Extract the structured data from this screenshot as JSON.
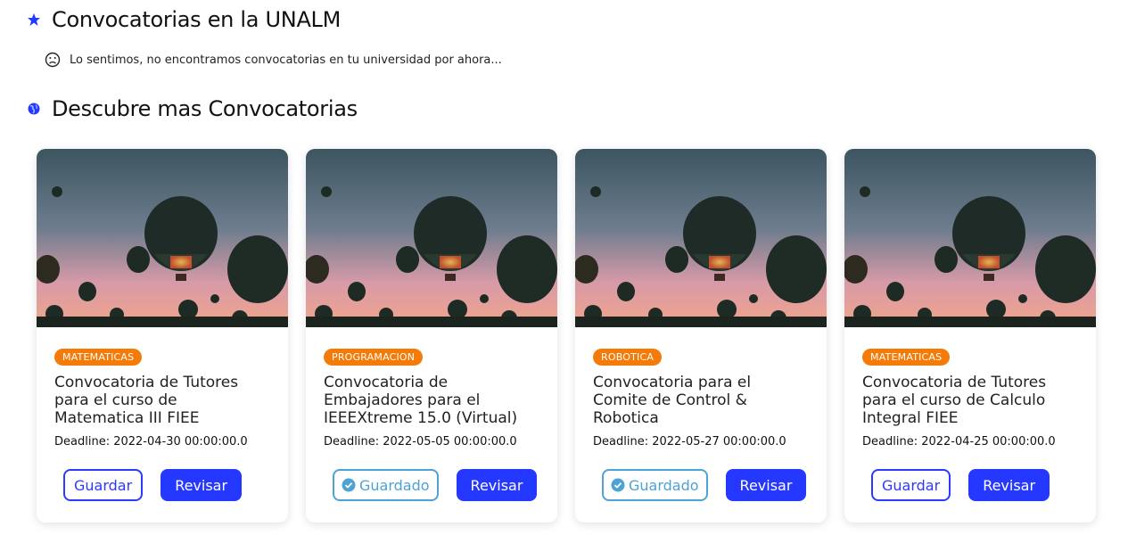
{
  "section1": {
    "title": "Convocatorias en la UNALM",
    "empty_message": "Lo sentimos, no encontramos convocatorias en tu universidad por ahora..."
  },
  "section2": {
    "title": "Descubre mas Convocatorias"
  },
  "cards": [
    {
      "tag": "MATEMATICAS",
      "title": "Convocatoria de Tutores para el curso de Matematica III FIEE",
      "deadline": "Deadline: 2022-04-30 00:00:00.0",
      "save_label": "Guardar",
      "saved": false,
      "review_label": "Revisar"
    },
    {
      "tag": "PROGRAMACION",
      "title": "Convocatoria de Embajadores para el IEEEXtreme 15.0 (Virtual)",
      "deadline": "Deadline: 2022-05-05 00:00:00.0",
      "save_label": "Guardado",
      "saved": true,
      "review_label": "Revisar"
    },
    {
      "tag": "ROBOTICA",
      "title": "Convocatoria para el Comite de Control & Robotica",
      "deadline": "Deadline: 2022-05-27 00:00:00.0",
      "save_label": "Guardado",
      "saved": true,
      "review_label": "Revisar"
    },
    {
      "tag": "MATEMATICAS",
      "title": "Convocatoria de Tutores para el curso de Calculo Integral FIEE",
      "deadline": "Deadline: 2022-04-25 00:00:00.0",
      "save_label": "Guardar",
      "saved": false,
      "review_label": "Revisar"
    }
  ],
  "colors": {
    "accent": "#2438ff",
    "saved": "#4da2d6",
    "tag": "#f47b08"
  }
}
